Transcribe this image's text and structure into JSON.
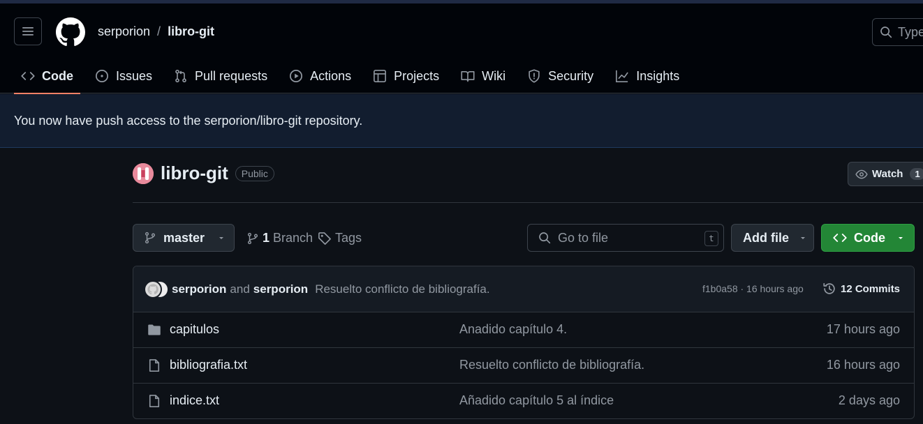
{
  "header": {
    "owner": "serporion",
    "separator": "/",
    "repo": "libro-git",
    "search_placeholder": "Type"
  },
  "tabs": [
    {
      "label": "Code",
      "icon": "code-icon",
      "active": true
    },
    {
      "label": "Issues",
      "icon": "issue-icon"
    },
    {
      "label": "Pull requests",
      "icon": "pull-request-icon"
    },
    {
      "label": "Actions",
      "icon": "play-icon"
    },
    {
      "label": "Projects",
      "icon": "table-icon"
    },
    {
      "label": "Wiki",
      "icon": "book-icon"
    },
    {
      "label": "Security",
      "icon": "shield-icon"
    },
    {
      "label": "Insights",
      "icon": "graph-icon"
    }
  ],
  "flash": {
    "message": "You now have push access to the serporion/libro-git repository."
  },
  "repo": {
    "title": "libro-git",
    "visibility": "Public",
    "watch_label": "Watch",
    "watch_count": "1"
  },
  "toolbar": {
    "branch": "master",
    "branch_count": "1",
    "branch_label": "Branch",
    "tags_label": "Tags",
    "gofile_placeholder": "Go to file",
    "gofile_shortcut": "t",
    "add_file_label": "Add file",
    "code_label": "Code"
  },
  "latest_commit": {
    "author1": "serporion",
    "and": "and",
    "author2": "serporion",
    "message": "Resuelto conflicto de bibliografía.",
    "info": "f1b0a58 · 16 hours ago",
    "commits_label": "12 Commits"
  },
  "files": [
    {
      "type": "folder",
      "name": "capitulos",
      "message": "Anadido capítulo 4.",
      "time": "17 hours ago"
    },
    {
      "type": "file",
      "name": "bibliografia.txt",
      "message": "Resuelto conflicto de bibliografía.",
      "time": "16 hours ago"
    },
    {
      "type": "file",
      "name": "indice.txt",
      "message": "Añadido capítulo 5 al índice",
      "time": "2 days ago"
    }
  ],
  "colors": {
    "background": "#0d1117",
    "header": "#010409",
    "accent_tab": "#f78166",
    "code_button": "#238636",
    "flash": "#121d2f"
  }
}
